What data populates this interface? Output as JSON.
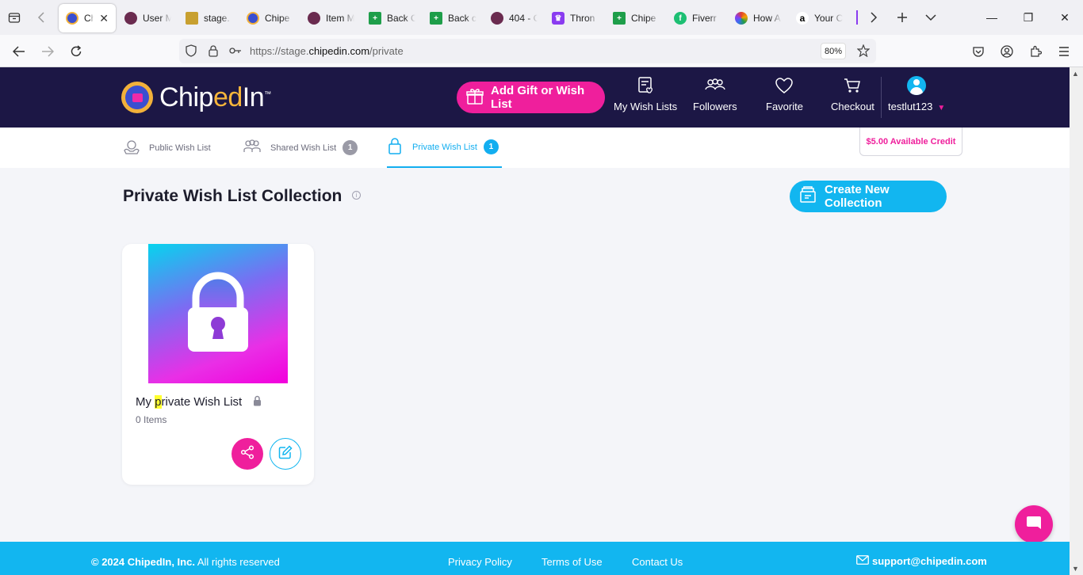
{
  "browser": {
    "tabs": [
      {
        "label": "Chi",
        "favicon_color": "#3a4fd0",
        "active": true
      },
      {
        "label": "User M",
        "favicon_color": "#6a2b4f"
      },
      {
        "label": "stage.",
        "favicon_color": "#c8a030"
      },
      {
        "label": "Chipe",
        "favicon_color": "#3a4fd0"
      },
      {
        "label": "Item M",
        "favicon_color": "#6a2b4f"
      },
      {
        "label": "Back C",
        "favicon_color": "#1e9e4a"
      },
      {
        "label": "Back c",
        "favicon_color": "#1e9e4a"
      },
      {
        "label": "404 - C",
        "favicon_color": "#6a2b4f"
      },
      {
        "label": "Thron",
        "favicon_color": "#8a3cf0"
      },
      {
        "label": "Chipe",
        "favicon_color": "#1e9e4a"
      },
      {
        "label": "Fiverr",
        "favicon_color": "#1dbf73"
      },
      {
        "label": "How A",
        "favicon_color": "#e04030"
      },
      {
        "label": "Your C",
        "favicon_color": "#f5a000"
      }
    ],
    "url_prefix": "https://stage.",
    "url_domain": "chipedin.com",
    "url_path": "/private",
    "zoom": "80%"
  },
  "header": {
    "logo": {
      "left": "Chip",
      "mid": "ed",
      "right": "In",
      "tm": "™"
    },
    "add_button": "Add Gift or Wish List",
    "nav": {
      "my_wish_lists": "My Wish Lists",
      "followers": "Followers",
      "favorite": "Favorite",
      "checkout": "Checkout",
      "username": "testlut123"
    },
    "colors": {
      "bg": "#1c1745",
      "accent": "#ef1f9c",
      "brand_blue": "#12b6f0"
    }
  },
  "subnav": {
    "public": {
      "label": "Public Wish List"
    },
    "shared": {
      "label": "Shared Wish List",
      "count": "1"
    },
    "private": {
      "label": "Private Wish List",
      "count": "1"
    },
    "credit": "$5.00 Available Credit"
  },
  "main": {
    "title": "Private Wish List Collection",
    "create_button": "Create New Collection",
    "collections": [
      {
        "title_before": "My ",
        "title_highlight": "p",
        "title_after": "rivate Wish List",
        "items": "0 Items"
      }
    ]
  },
  "footer": {
    "copyright_bold": "© 2024 ChipedIn, Inc.",
    "copyright_rest": " All rights reserved",
    "privacy": "Privacy Policy",
    "terms": "Terms of Use",
    "contact": "Contact Us",
    "email": "support@chipedin.com"
  }
}
